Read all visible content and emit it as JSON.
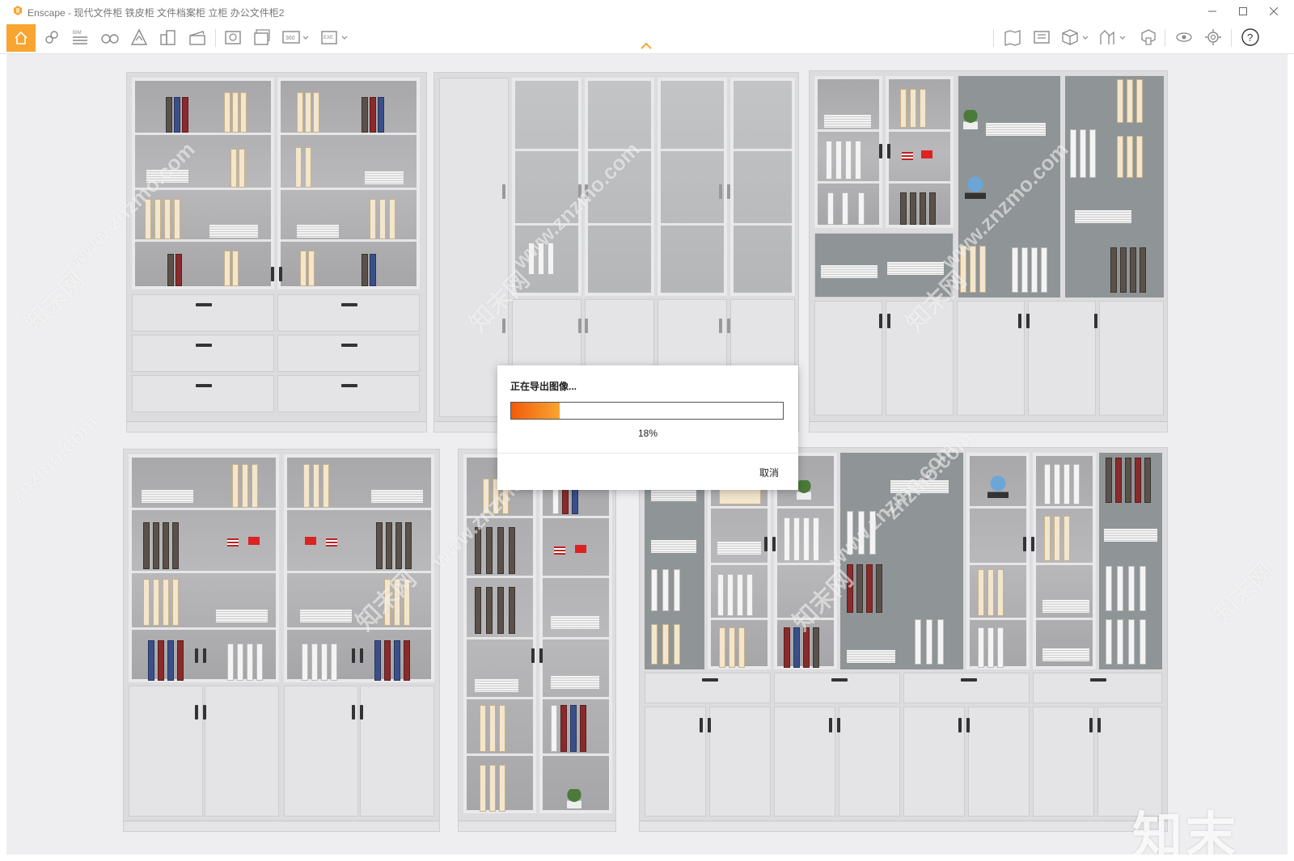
{
  "window": {
    "title": "Enscape - 现代文件柜 铁皮柜 文件档案柜 立柜 办公文件柜2",
    "min_icon": "minimize-icon",
    "max_icon": "maximize-icon",
    "close_icon": "close-icon"
  },
  "toolbar": {
    "left_icons": [
      "home-icon",
      "link-icon",
      "bim-icon",
      "binoculars-icon",
      "atmosphere-icon",
      "buildings-icon",
      "clapper-icon",
      "screenshot-icon",
      "batch-render-icon",
      "panorama-360-icon",
      "export-exe-icon"
    ],
    "bim_label": "BIM",
    "pano_label": "360",
    "exe_label": "EXE",
    "right_icons": [
      "map-icon",
      "viewfinder-icon",
      "cube-icon",
      "asset-library-icon",
      "materials-icon",
      "visual-settings-icon",
      "settings-gear-icon",
      "help-icon"
    ],
    "help_label": "?",
    "accent": "#f8a531"
  },
  "dialog": {
    "title": "正在导出图像...",
    "progress": 18,
    "progress_label": "18%",
    "cancel_label": "取消",
    "fill_start": "#f25b0a",
    "fill_end": "#f8a531"
  },
  "watermarks": {
    "site": "www.znzmo.com",
    "site_short": "znzmo.com",
    "cn": "知末网",
    "brand": "知末",
    "id": "ID: 1130865986"
  }
}
